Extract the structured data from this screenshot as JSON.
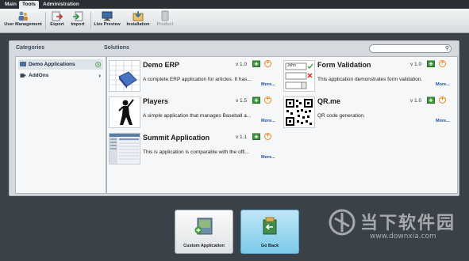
{
  "tabs": [
    {
      "label": "Main",
      "active": false
    },
    {
      "label": "Tools",
      "active": true
    },
    {
      "label": "Administration",
      "active": false
    }
  ],
  "toolbar": {
    "user_management": "User Management",
    "export": "Export",
    "import": "Import",
    "live_preview": "Live Preview",
    "installation": "Installation",
    "product": "Product"
  },
  "categories": {
    "title": "Categories",
    "items": [
      {
        "label": "Demo Applications",
        "selected": true
      },
      {
        "label": "AddOns",
        "selected": false
      }
    ]
  },
  "solutions": {
    "title": "Solutions",
    "search_placeholder": "",
    "more_label": "More...",
    "items": [
      {
        "name": "Demo ERP",
        "version": "v 1.0",
        "description": "A complete ERP application for articles. It has..."
      },
      {
        "name": "Form Validation",
        "version": "v 1.0",
        "description": "This application demonstrates form validation."
      },
      {
        "name": "Players",
        "version": "v 1.5",
        "description": "A simple application that manages Baseball a..."
      },
      {
        "name": "QR.me",
        "version": "v 1.0",
        "description": "QR code generation."
      },
      {
        "name": "Summit Application",
        "version": "v 1.1",
        "description": "This is application is comparable with the offi..."
      }
    ]
  },
  "form_thumb": {
    "name_value": "John"
  },
  "bottom": {
    "custom_application": "Custom Application",
    "go_back": "Go Back"
  },
  "watermark": {
    "text": "当下软件园",
    "url": "www.downxia.com"
  },
  "colors": {
    "accent_orange": "#e58a1f",
    "link_blue": "#1f4fa3",
    "add_green": "#3f9a3c"
  }
}
